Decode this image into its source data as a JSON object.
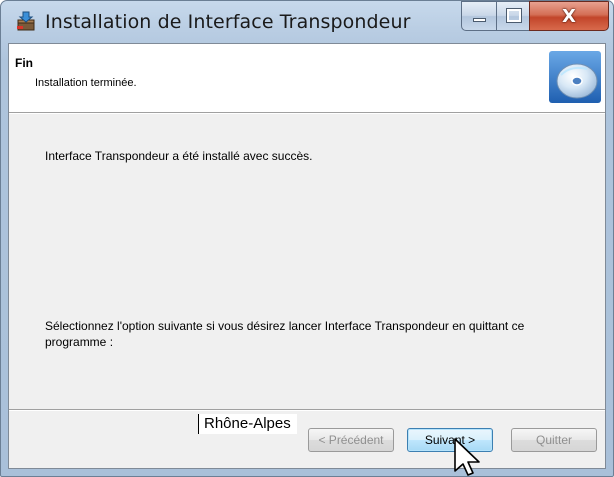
{
  "window": {
    "title": "Installation de Interface Transpondeur",
    "icons": {
      "app": "installer-box-icon",
      "minimize": "minimize-icon",
      "maximize": "maximize-icon",
      "close": "close-icon"
    },
    "close_glyph": "X"
  },
  "banner": {
    "title": "Fin",
    "subtitle": "Installation terminée.",
    "icon": "cd-disc-icon"
  },
  "content": {
    "message": "Interface Transpondeur a été installé avec succès.",
    "option_prompt": "Sélectionnez l'option suivante si vous désirez lancer Interface Transpondeur en quittant ce programme :"
  },
  "watermark": "Rhône-Alpes",
  "buttons": {
    "previous": "< Précédent",
    "next": "Suivant >",
    "quit": "Quitter"
  },
  "colors": {
    "close_button": "#c2452a",
    "next_button_border": "#3c7fb1",
    "disabled_text": "#8f8f8f"
  }
}
